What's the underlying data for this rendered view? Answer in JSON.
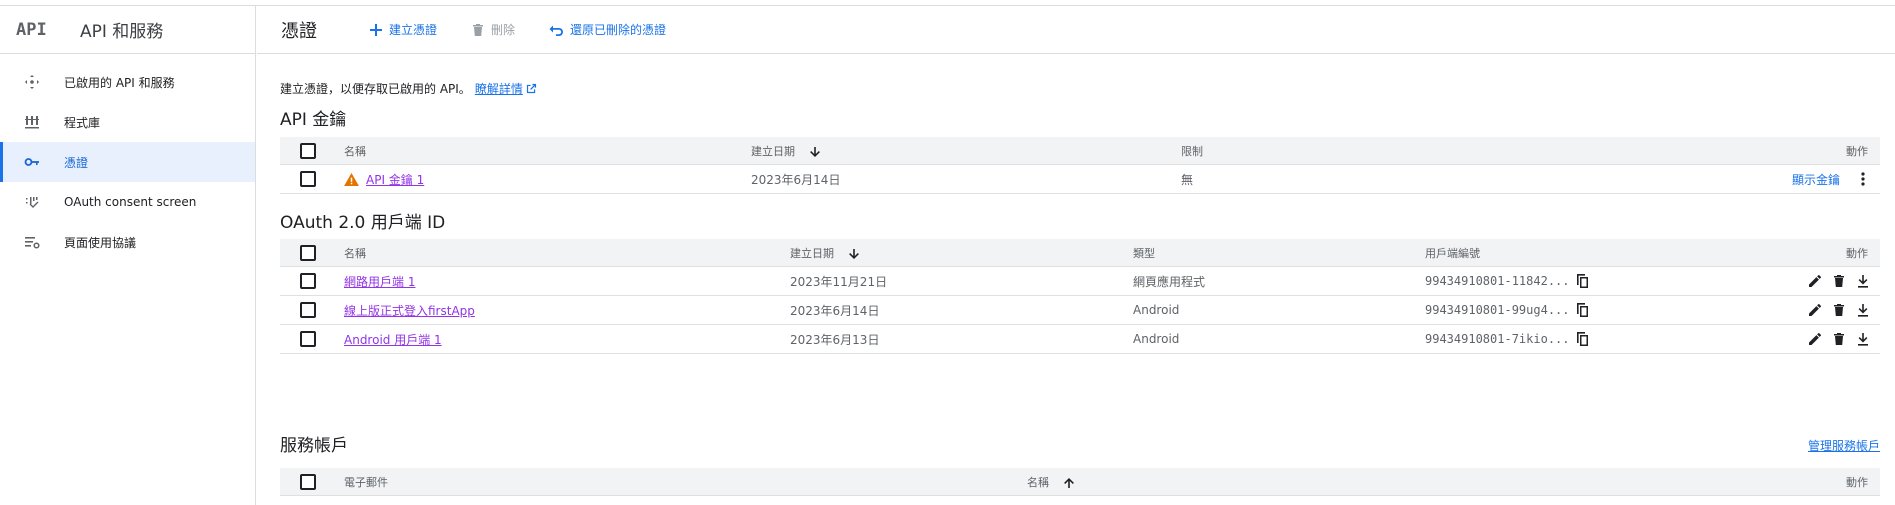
{
  "app": {
    "logo": "API",
    "title": "API 和服務"
  },
  "sidebar": {
    "items": [
      {
        "label": "已啟用的 API 和服務",
        "icon": "api-services-icon"
      },
      {
        "label": "程式庫",
        "icon": "library-icon"
      },
      {
        "label": "憑證",
        "icon": "key-icon",
        "active": true
      },
      {
        "label": "OAuth consent screen",
        "icon": "consent-icon"
      },
      {
        "label": "頁面使用協議",
        "icon": "settings-list-icon"
      }
    ]
  },
  "header": {
    "title": "憑證",
    "create_label": "建立憑證",
    "delete_label": "刪除",
    "restore_label": "還原已刪除的憑證"
  },
  "intro": {
    "text": "建立憑證，以便存取已啟用的 API。",
    "link": "瞭解詳情"
  },
  "api_keys": {
    "title": "API 金鑰",
    "columns": {
      "name": "名稱",
      "created": "建立日期",
      "restrictions": "限制",
      "actions": "動作"
    },
    "rows": [
      {
        "name": "API 金鑰 1",
        "created": "2023年6月14日",
        "restrictions": "無",
        "show_key": "顯示金鑰"
      }
    ]
  },
  "oauth": {
    "title": "OAuth 2.0 用戶端 ID",
    "columns": {
      "name": "名稱",
      "created": "建立日期",
      "type": "類型",
      "client_id": "用戶端編號",
      "actions": "動作"
    },
    "rows": [
      {
        "name": "網路用戶端 1",
        "created": "2023年11月21日",
        "type": "網頁應用程式",
        "client_id": "99434910801-11842..."
      },
      {
        "name": "線上版正式登入firstApp",
        "created": "2023年6月14日",
        "type": "Android",
        "client_id": "99434910801-99ug4..."
      },
      {
        "name": "Android 用戶端 1",
        "created": "2023年6月13日",
        "type": "Android",
        "client_id": "99434910801-7ikio..."
      }
    ]
  },
  "service_accounts": {
    "title": "服務帳戶",
    "manage_link": "管理服務帳戶",
    "columns": {
      "email": "電子郵件",
      "name": "名稱",
      "actions": "動作"
    }
  },
  "colors": {
    "accent": "#1a73e8",
    "link_visited": "#9334e6",
    "active_bg": "#e8f0fe",
    "warning": "#e37400"
  }
}
